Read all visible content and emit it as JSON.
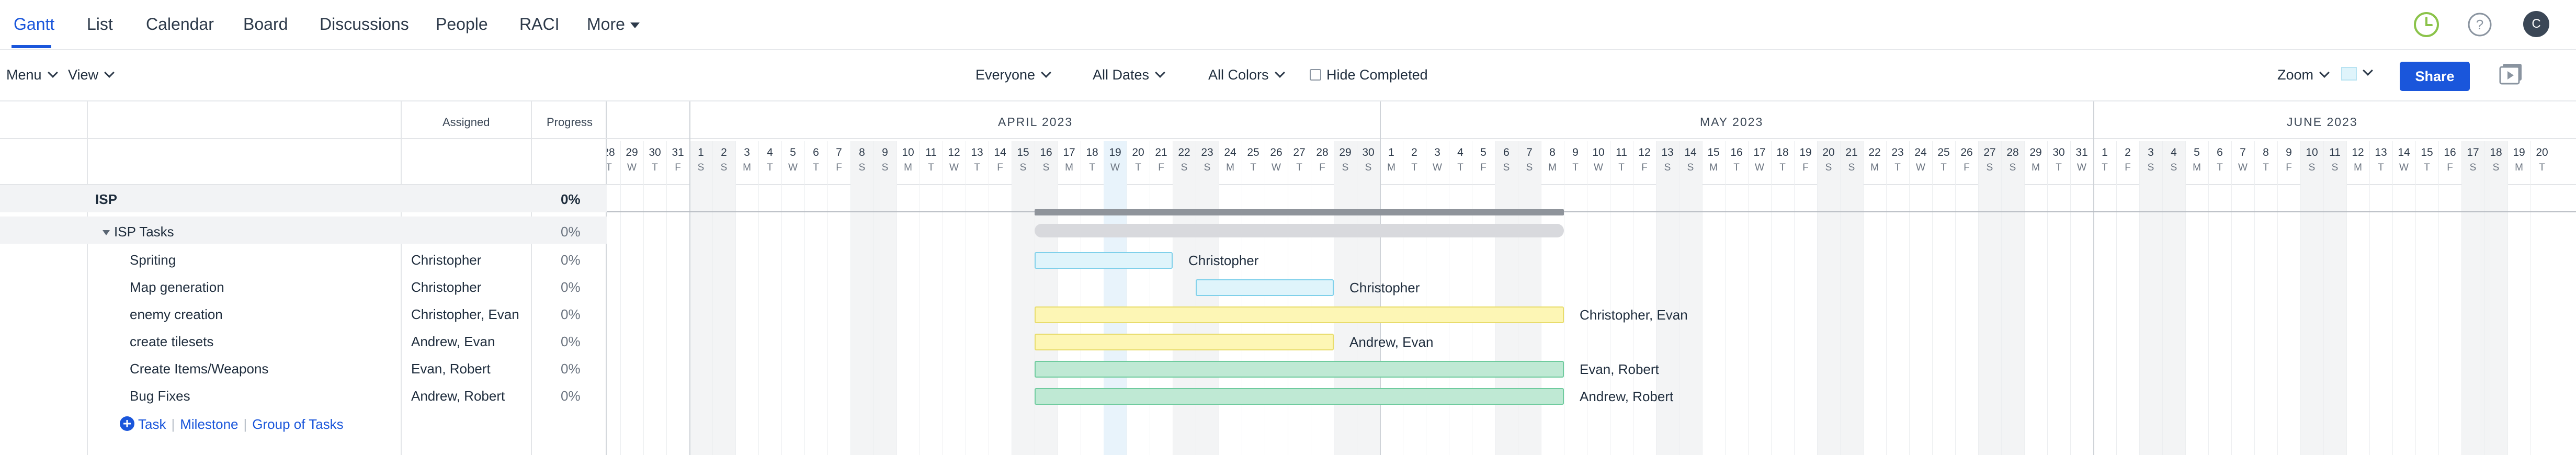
{
  "nav": {
    "tabs": [
      "Gantt",
      "List",
      "Calendar",
      "Board",
      "Discussions",
      "People",
      "RACI",
      "More"
    ],
    "avatar": "C"
  },
  "toolbar": {
    "menu": "Menu",
    "view": "View",
    "everyone": "Everyone",
    "dates": "All Dates",
    "colors": "All Colors",
    "hide_completed": "Hide Completed",
    "zoom": "Zoom",
    "share": "Share"
  },
  "grid": {
    "col_assigned": "Assigned",
    "col_progress": "Progress",
    "project": {
      "name": "ISP",
      "progress": "0%"
    },
    "group": {
      "name": "ISP Tasks",
      "progress": "0%"
    },
    "tasks": [
      {
        "name": "Spriting",
        "assigned": "Christopher",
        "progress": "0%",
        "start": 19,
        "end": 25,
        "color": "cyan"
      },
      {
        "name": "Map generation",
        "assigned": "Christopher",
        "progress": "0%",
        "start": 26,
        "end": 32,
        "color": "cyan"
      },
      {
        "name": "enemy creation",
        "assigned": "Christopher, Evan",
        "progress": "0%",
        "start": 19,
        "end": 42,
        "color": "yellow"
      },
      {
        "name": "create tilesets",
        "assigned": "Andrew, Evan",
        "progress": "0%",
        "start": 19,
        "end": 32,
        "color": "yellow"
      },
      {
        "name": "Create Items/Weapons",
        "assigned": "Evan, Robert",
        "progress": "0%",
        "start": 19,
        "end": 42,
        "color": "green"
      },
      {
        "name": "Bug Fixes",
        "assigned": "Andrew, Robert",
        "progress": "0%",
        "start": 19,
        "end": 42,
        "color": "green"
      }
    ],
    "add": {
      "task": "Task",
      "milestone": "Milestone",
      "group": "Group of Tasks"
    }
  },
  "timeline": {
    "months": [
      "APRIL 2023",
      "MAY 2023",
      "JUNE 2023"
    ],
    "days": [
      {
        "n": "28",
        "l": "T"
      },
      {
        "n": "29",
        "l": "W"
      },
      {
        "n": "30",
        "l": "T"
      },
      {
        "n": "31",
        "l": "F"
      },
      {
        "n": "1",
        "l": "S"
      },
      {
        "n": "2",
        "l": "S"
      },
      {
        "n": "3",
        "l": "M"
      },
      {
        "n": "4",
        "l": "T"
      },
      {
        "n": "5",
        "l": "W"
      },
      {
        "n": "6",
        "l": "T"
      },
      {
        "n": "7",
        "l": "F"
      },
      {
        "n": "8",
        "l": "S"
      },
      {
        "n": "9",
        "l": "S"
      },
      {
        "n": "10",
        "l": "M"
      },
      {
        "n": "11",
        "l": "T"
      },
      {
        "n": "12",
        "l": "W"
      },
      {
        "n": "13",
        "l": "T"
      },
      {
        "n": "14",
        "l": "F"
      },
      {
        "n": "15",
        "l": "S"
      },
      {
        "n": "16",
        "l": "S"
      },
      {
        "n": "17",
        "l": "M"
      },
      {
        "n": "18",
        "l": "T"
      },
      {
        "n": "19",
        "l": "W"
      },
      {
        "n": "20",
        "l": "T"
      },
      {
        "n": "21",
        "l": "F"
      },
      {
        "n": "22",
        "l": "S"
      },
      {
        "n": "23",
        "l": "S"
      },
      {
        "n": "24",
        "l": "M"
      },
      {
        "n": "25",
        "l": "T"
      },
      {
        "n": "26",
        "l": "W"
      },
      {
        "n": "27",
        "l": "T"
      },
      {
        "n": "28",
        "l": "F"
      },
      {
        "n": "29",
        "l": "S"
      },
      {
        "n": "30",
        "l": "S"
      },
      {
        "n": "1",
        "l": "M"
      },
      {
        "n": "2",
        "l": "T"
      },
      {
        "n": "3",
        "l": "W"
      },
      {
        "n": "4",
        "l": "T"
      },
      {
        "n": "5",
        "l": "F"
      },
      {
        "n": "6",
        "l": "S"
      },
      {
        "n": "7",
        "l": "S"
      },
      {
        "n": "8",
        "l": "M"
      },
      {
        "n": "9",
        "l": "T"
      },
      {
        "n": "10",
        "l": "W"
      },
      {
        "n": "11",
        "l": "T"
      },
      {
        "n": "12",
        "l": "F"
      },
      {
        "n": "13",
        "l": "S"
      },
      {
        "n": "14",
        "l": "S"
      },
      {
        "n": "15",
        "l": "M"
      },
      {
        "n": "16",
        "l": "T"
      },
      {
        "n": "17",
        "l": "W"
      },
      {
        "n": "18",
        "l": "T"
      },
      {
        "n": "19",
        "l": "F"
      },
      {
        "n": "20",
        "l": "S"
      },
      {
        "n": "21",
        "l": "S"
      },
      {
        "n": "22",
        "l": "M"
      },
      {
        "n": "23",
        "l": "T"
      },
      {
        "n": "24",
        "l": "W"
      },
      {
        "n": "25",
        "l": "T"
      },
      {
        "n": "26",
        "l": "F"
      },
      {
        "n": "27",
        "l": "S"
      },
      {
        "n": "28",
        "l": "S"
      },
      {
        "n": "29",
        "l": "M"
      },
      {
        "n": "30",
        "l": "T"
      },
      {
        "n": "31",
        "l": "W"
      },
      {
        "n": "1",
        "l": "T"
      },
      {
        "n": "2",
        "l": "F"
      },
      {
        "n": "3",
        "l": "S"
      },
      {
        "n": "4",
        "l": "S"
      },
      {
        "n": "5",
        "l": "M"
      },
      {
        "n": "6",
        "l": "T"
      },
      {
        "n": "7",
        "l": "W"
      },
      {
        "n": "8",
        "l": "T"
      },
      {
        "n": "9",
        "l": "F"
      },
      {
        "n": "10",
        "l": "S"
      },
      {
        "n": "11",
        "l": "S"
      },
      {
        "n": "12",
        "l": "M"
      },
      {
        "n": "13",
        "l": "T"
      },
      {
        "n": "14",
        "l": "W"
      },
      {
        "n": "15",
        "l": "T"
      },
      {
        "n": "16",
        "l": "F"
      },
      {
        "n": "17",
        "l": "S"
      },
      {
        "n": "18",
        "l": "S"
      },
      {
        "n": "19",
        "l": "M"
      },
      {
        "n": "20",
        "l": "T"
      }
    ],
    "today_index": 22,
    "colors": {
      "accent": "#1a56db",
      "cyan": "#7fd0ea",
      "yellow": "#e8dc6c",
      "green": "#6fcb9e"
    }
  }
}
